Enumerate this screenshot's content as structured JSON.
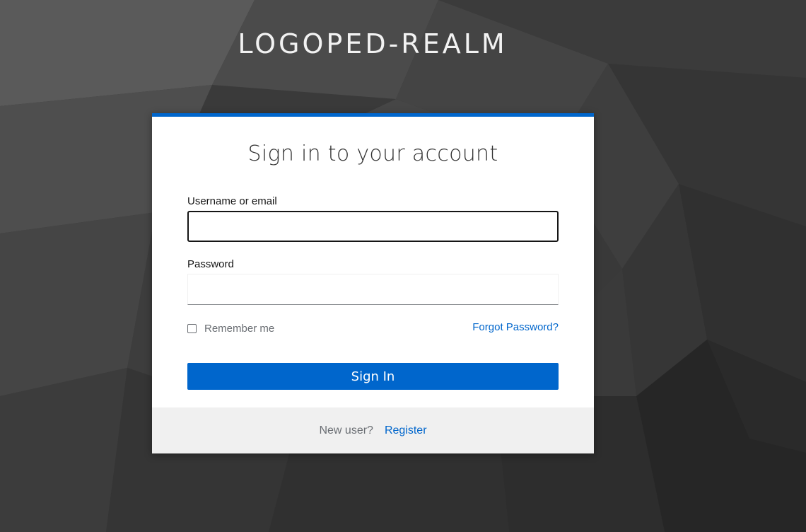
{
  "realm": {
    "title": "LOGOPED-REALM"
  },
  "login": {
    "heading": "Sign in to your account",
    "username_label": "Username or email",
    "username_value": "",
    "password_label": "Password",
    "password_value": "",
    "remember_me_label": "Remember me",
    "remember_me_checked": false,
    "forgot_password_label": "Forgot Password?",
    "sign_in_label": "Sign In"
  },
  "footer": {
    "new_user_text": "New user?",
    "register_label": "Register"
  },
  "colors": {
    "accent": "#0066cc",
    "background": "#3a3a3a",
    "card": "#ffffff",
    "footer": "#f0f0f0"
  }
}
